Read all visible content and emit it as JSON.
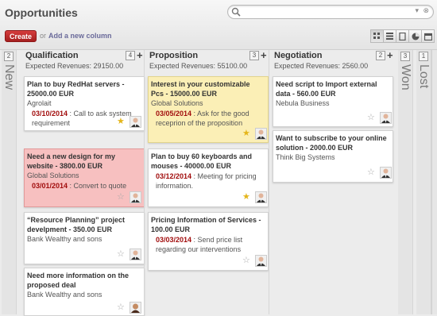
{
  "header": {
    "title": "Opportunities",
    "create_label": "Create",
    "or_label": "or",
    "add_column_label": "Add a new column",
    "search_value": ""
  },
  "view_icons": [
    "kanban-view-icon",
    "list-view-icon",
    "form-view-icon",
    "graph-view-icon",
    "calendar-view-icon"
  ],
  "folded_columns": {
    "new": {
      "count": "2",
      "title": "New"
    },
    "won": {
      "count": "3",
      "title": "Won"
    },
    "lost": {
      "count": "1",
      "title": "Lost"
    }
  },
  "columns": {
    "qualification": {
      "title": "Qualification",
      "count": "4",
      "plus": "+",
      "expected": "Expected Revenues: 29150.00",
      "cards": [
        {
          "title": "Plan to buy RedHat servers - 25000.00 EUR",
          "partner": "Agrolait",
          "date": "03/10/2014",
          "activity": " : Call to ask system requirement"
        },
        {
          "title": "Need a new design for my website - 3800.00 EUR",
          "partner": "",
          "date": "03/01/2014",
          "activity": " : Convert to quote"
        },
        {
          "title": "“Resource Planning” project develpment - 350.00 EUR",
          "partner": "Bank Wealthy and sons",
          "date": "",
          "activity": ""
        },
        {
          "title": "Need more information on the proposed deal",
          "partner": "Bank Wealthy and sons",
          "date": "",
          "activity": ""
        }
      ]
    },
    "proposition": {
      "title": "Proposition",
      "count": "3",
      "plus": "+",
      "expected": "Expected Revenues: 55100.00",
      "cards": [
        {
          "title": "Interest in your customizable Pcs - 15000.00 EUR",
          "partner": "Global Solutions",
          "date": "03/05/2014",
          "activity": " : Ask for the good receprion of the proposition"
        },
        {
          "title": "Plan to buy 60 keyboards and mouses - 40000.00 EUR",
          "partner": "",
          "date": "03/12/2014",
          "activity": " : Meeting for pricing information."
        },
        {
          "title": "Pricing Information of Services - 100.00 EUR",
          "partner": "",
          "date": "03/03/2014",
          "activity": " : Send price list regarding our interventions"
        }
      ]
    },
    "negotiation": {
      "title": "Negotiation",
      "count": "2",
      "plus": "+",
      "expected": "Expected Revenues: 2560.00",
      "cards": [
        {
          "title": "Need script to Import external data - 560.00 EUR",
          "partner": "Nebula Business",
          "date": "",
          "activity": ""
        },
        {
          "title": "Want to subscribe to your online solution - 2000.00 EUR",
          "partner": "Think Big Systems",
          "date": "",
          "activity": ""
        }
      ]
    }
  },
  "qualification_card2_partner": "Global Solutions",
  "colors": {
    "create": "#c12b2b",
    "priority_star": "#e4b51a",
    "activity_date": "#a10d0d",
    "card_yellow": "#fbefb6",
    "card_red": "#f7c0c0"
  }
}
